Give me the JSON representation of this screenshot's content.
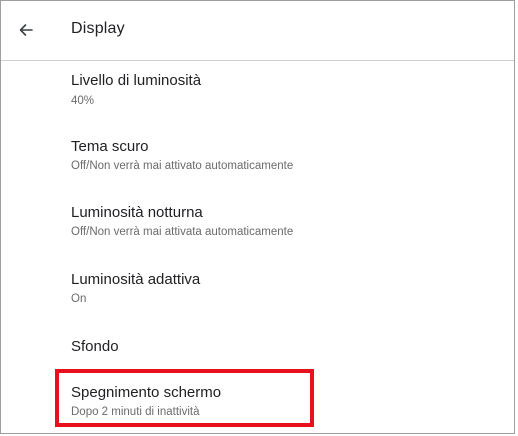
{
  "header": {
    "back_icon": "arrow-left-icon",
    "title": "Display"
  },
  "settings": {
    "items": [
      {
        "title": "Livello di luminosità",
        "summary": "40%"
      },
      {
        "title": "Tema scuro",
        "summary": "Off/Non verrà mai attivato automaticamente"
      },
      {
        "title": "Luminosità notturna",
        "summary": "Off/Non verrà mai attivata automaticamente"
      },
      {
        "title": "Luminosità adattiva",
        "summary": "On"
      },
      {
        "title": "Sfondo"
      },
      {
        "title": "Spegnimento schermo",
        "summary": "Dopo 2 minuti di inattività"
      }
    ]
  },
  "annotation": {
    "highlight_color": "#e8101c"
  }
}
